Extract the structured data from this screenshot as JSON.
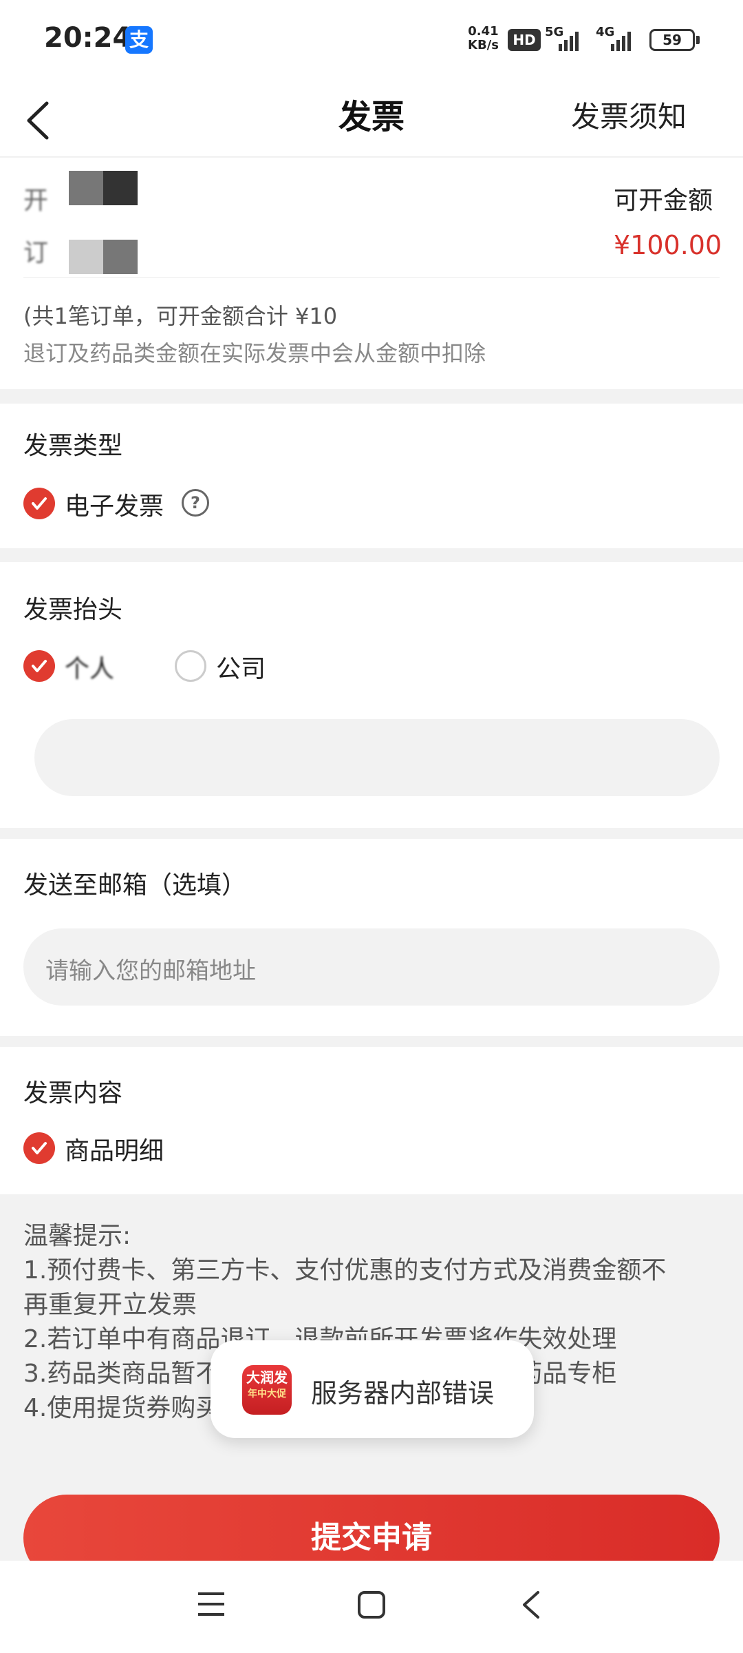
{
  "status_bar": {
    "time": "20:24",
    "alipay_icon": "支",
    "speed_value": "0.41",
    "speed_unit": "KB/s",
    "hd_label": "HD",
    "net1": "5G",
    "net2": "4G",
    "battery": "59"
  },
  "nav": {
    "title": "发票",
    "notice_link": "发票须知"
  },
  "order": {
    "line1_prefix": "开",
    "line2_prefix": "订",
    "amount_label": "可开金额",
    "amount_value": "¥100.00",
    "summary": "(共1笔订单，可开金额合计 ¥10",
    "deduct_note": "退订及药品类金额在实际发票中会从金额中扣除"
  },
  "invoice_type": {
    "heading": "发票类型",
    "option": "电子发票",
    "help_icon": "?"
  },
  "invoice_title": {
    "heading": "发票抬头",
    "option_personal": "个人",
    "option_company": "公司"
  },
  "email": {
    "heading": "发送至邮箱（选填）",
    "placeholder": "请输入您的邮箱地址"
  },
  "content": {
    "heading": "发票内容",
    "option": "商品明细"
  },
  "tips": {
    "heading": "温馨提示:",
    "line1": "1.预付费卡、第三方卡、支付优惠的支付方式及消费金额不",
    "line1b": "再重复开立发票",
    "line2": "2.若订单中有商品退订，退款前所开发票将作失效处理",
    "line3": "3.药品类商品暂不支持开票，如需请联系门店药品专柜",
    "line4": "4.使用提货券购买的商品暂不支持开票"
  },
  "toast": {
    "app_icon_text": "大润发",
    "app_icon_sub": "年中大促",
    "message": "服务器内部错误"
  },
  "submit_label": "提交申请",
  "colors": {
    "accent": "#e03b30",
    "price": "#d8312b"
  }
}
